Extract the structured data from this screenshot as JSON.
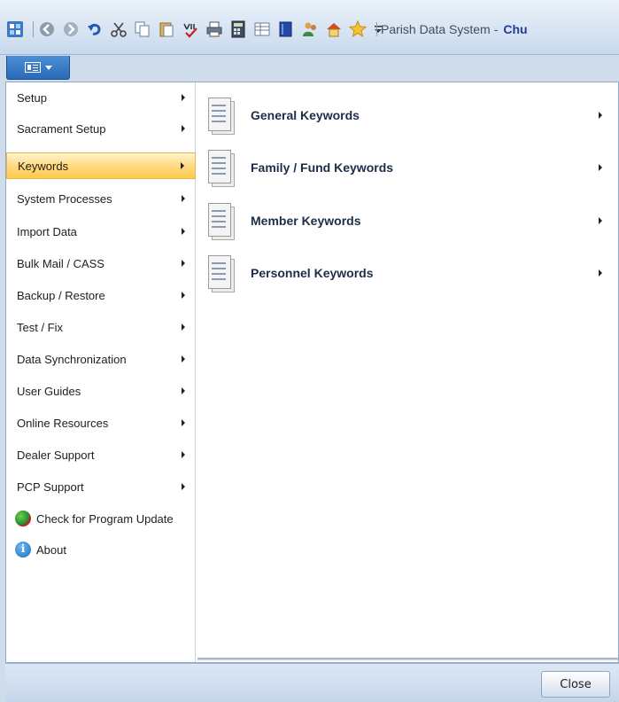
{
  "window": {
    "app_title": "Parish Data System",
    "title_separator": "-",
    "church_name": "Chu"
  },
  "toolbar": {
    "icons": [
      "app-logo-icon",
      "back-icon",
      "forward-icon",
      "undo-icon",
      "cut-icon",
      "copy-icon",
      "paste-icon",
      "spellcheck-icon",
      "print-icon",
      "calculator-icon",
      "grid-icon",
      "book-icon",
      "users-icon",
      "home-icon",
      "favorite-star-icon",
      "customize-dropdown-icon"
    ]
  },
  "left_menu": {
    "items": [
      {
        "label": "Setup",
        "has_submenu": true
      },
      {
        "label": "Sacrament Setup",
        "has_submenu": true
      },
      {
        "label": "Keywords",
        "has_submenu": true,
        "active": true
      },
      {
        "label": "System Processes",
        "has_submenu": true
      },
      {
        "label": "Import Data",
        "has_submenu": true
      },
      {
        "label": "Bulk Mail / CASS",
        "has_submenu": true
      },
      {
        "label": "Backup / Restore",
        "has_submenu": true
      },
      {
        "label": "Test / Fix",
        "has_submenu": true
      },
      {
        "label": "Data Synchronization",
        "has_submenu": true
      },
      {
        "label": "User Guides",
        "has_submenu": true
      },
      {
        "label": "Online Resources",
        "has_submenu": true
      },
      {
        "label": "Dealer Support",
        "has_submenu": true
      },
      {
        "label": "PCP Support",
        "has_submenu": true
      }
    ],
    "check_update_label": "Check for Program Update",
    "about_label": "About"
  },
  "submenu": {
    "items": [
      {
        "label": "General Keywords"
      },
      {
        "label": "Family / Fund Keywords"
      },
      {
        "label": "Member Keywords"
      },
      {
        "label": "Personnel Keywords"
      }
    ]
  },
  "footer": {
    "close_label": "Close"
  },
  "colors": {
    "accent": "#2a6ab8",
    "active_highlight": "#ffd87a",
    "church_name": "#1f3d9a"
  }
}
